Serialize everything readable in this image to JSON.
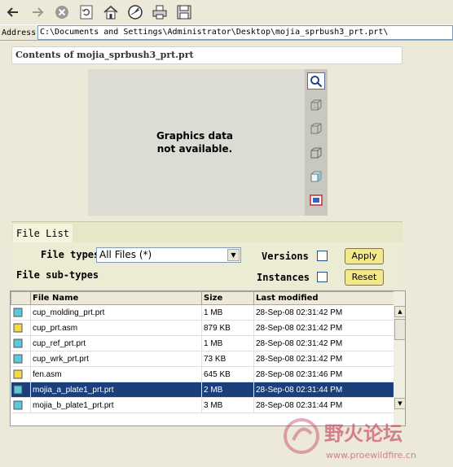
{
  "toolbar": {
    "icons": [
      "back-arrow-icon",
      "forward-arrow-icon",
      "stop-icon",
      "refresh-icon",
      "home-icon",
      "history-icon",
      "print-icon",
      "save-icon"
    ]
  },
  "address": {
    "label": "Address",
    "value": "C:\\Documents and Settings\\Administrator\\Desktop\\mojia_sprbush3_prt.prt\\"
  },
  "contents_title": "Contents of mojia_sprbush3_prt.prt",
  "preview": {
    "line1": "Graphics data",
    "line2": "not available."
  },
  "file_list": {
    "tab_label": "File List",
    "file_types_label": "File types",
    "file_types_selected": "All Files (*)",
    "file_subtypes_label": "File sub-types",
    "versions_label": "Versions",
    "instances_label": "Instances",
    "apply_label": "Apply",
    "reset_label": "Reset",
    "columns": [
      "File Name",
      "Size",
      "Last modified"
    ],
    "rows": [
      {
        "name": "cup_molding_prt.prt",
        "size": "1 MB",
        "modified": "28-Sep-08 02:31:42 PM",
        "type": "prt"
      },
      {
        "name": "cup_prt.asm",
        "size": "879 KB",
        "modified": "28-Sep-08 02:31:42 PM",
        "type": "asm"
      },
      {
        "name": "cup_ref_prt.prt",
        "size": "1 MB",
        "modified": "28-Sep-08 02:31:42 PM",
        "type": "prt"
      },
      {
        "name": "cup_wrk_prt.prt",
        "size": "73 KB",
        "modified": "28-Sep-08 02:31:42 PM",
        "type": "prt"
      },
      {
        "name": "fen.asm",
        "size": "645 KB",
        "modified": "28-Sep-08 02:31:46 PM",
        "type": "asm"
      },
      {
        "name": "mojia_a_plate1_prt.prt",
        "size": "2 MB",
        "modified": "28-Sep-08 02:31:44 PM",
        "type": "prt",
        "selected": true
      },
      {
        "name": "mojia_b_plate1_prt.prt",
        "size": "3 MB",
        "modified": "28-Sep-08 02:31:44 PM",
        "type": "prt"
      }
    ]
  },
  "watermark": {
    "text_cn": "野火论坛",
    "url": "www.proewildfire.cn"
  },
  "colors": {
    "selected_row": "#1b3f7a",
    "button_yellow": "#f3e88a",
    "watermark": "#c0395b"
  }
}
